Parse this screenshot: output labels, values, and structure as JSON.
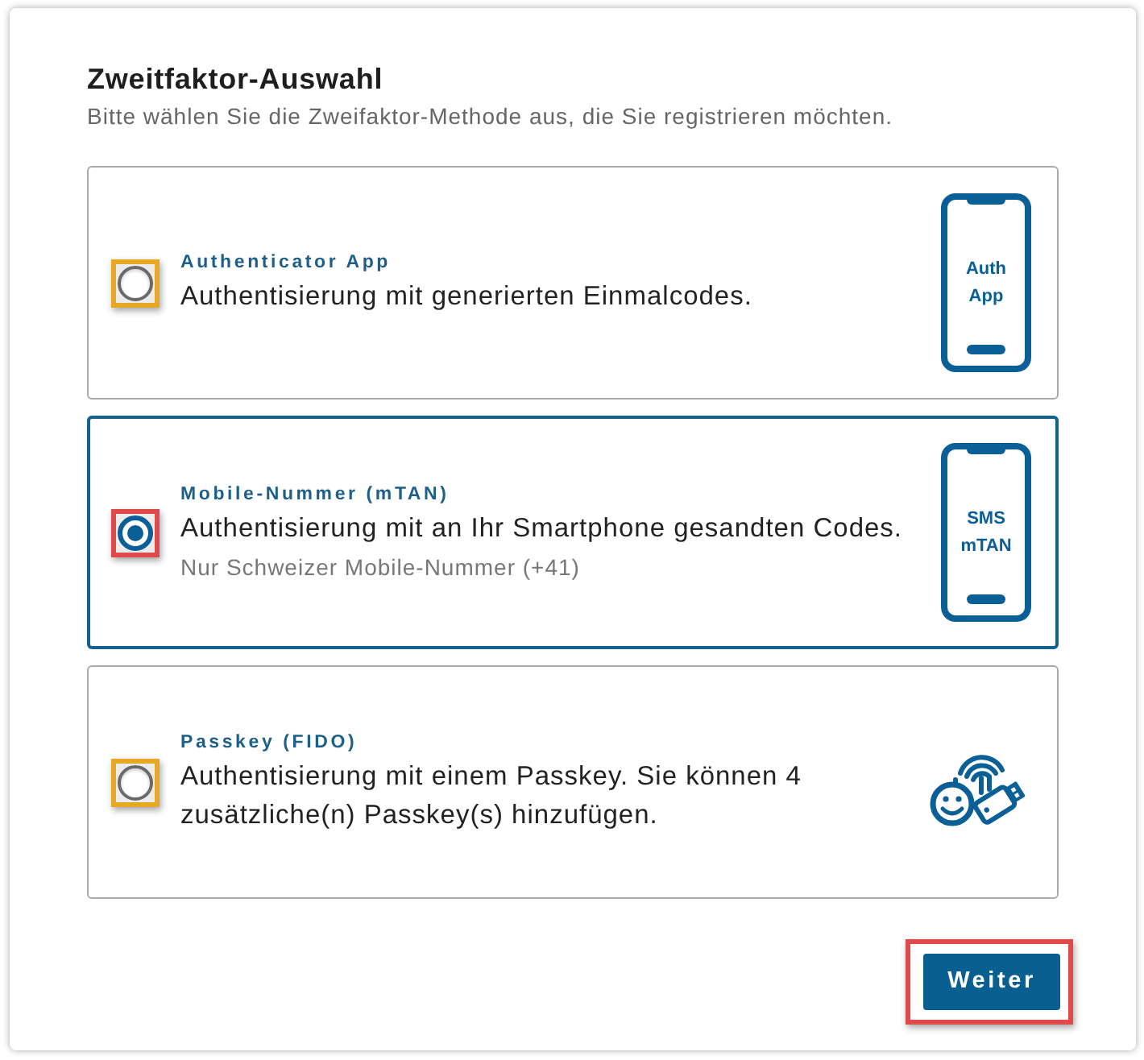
{
  "heading": {
    "title": "Zweitfaktor-Auswahl",
    "subtitle": "Bitte wählen Sie die Zweifaktor-Methode aus, die Sie registrieren möchten."
  },
  "options": [
    {
      "label": "Authenticator App",
      "description": "Authentisierung mit generierten Einmalcodes.",
      "selected": false,
      "color": "#e8a825",
      "icon": {
        "kind": "phone",
        "lines": [
          "Auth",
          "App"
        ]
      }
    },
    {
      "label": "Mobile-Nummer (mTAN)",
      "description": "Authentisierung mit an Ihr Smartphone gesandten Codes.",
      "note": "Nur Schweizer Mobile-Nummer (+41)",
      "selected": true,
      "color": "#e04a4a",
      "icon": {
        "kind": "phone",
        "lines": [
          "SMS",
          "mTAN"
        ]
      }
    },
    {
      "label": "Passkey (FIDO)",
      "description": "Authentisierung mit einem Passkey. Sie können 4 zusätzliche(n) Passkey(s) hinzufügen.",
      "selected": false,
      "color": "#e8a825",
      "icon": {
        "kind": "passkey"
      }
    }
  ],
  "submit": {
    "label": "Weiter",
    "highlighted": true
  }
}
